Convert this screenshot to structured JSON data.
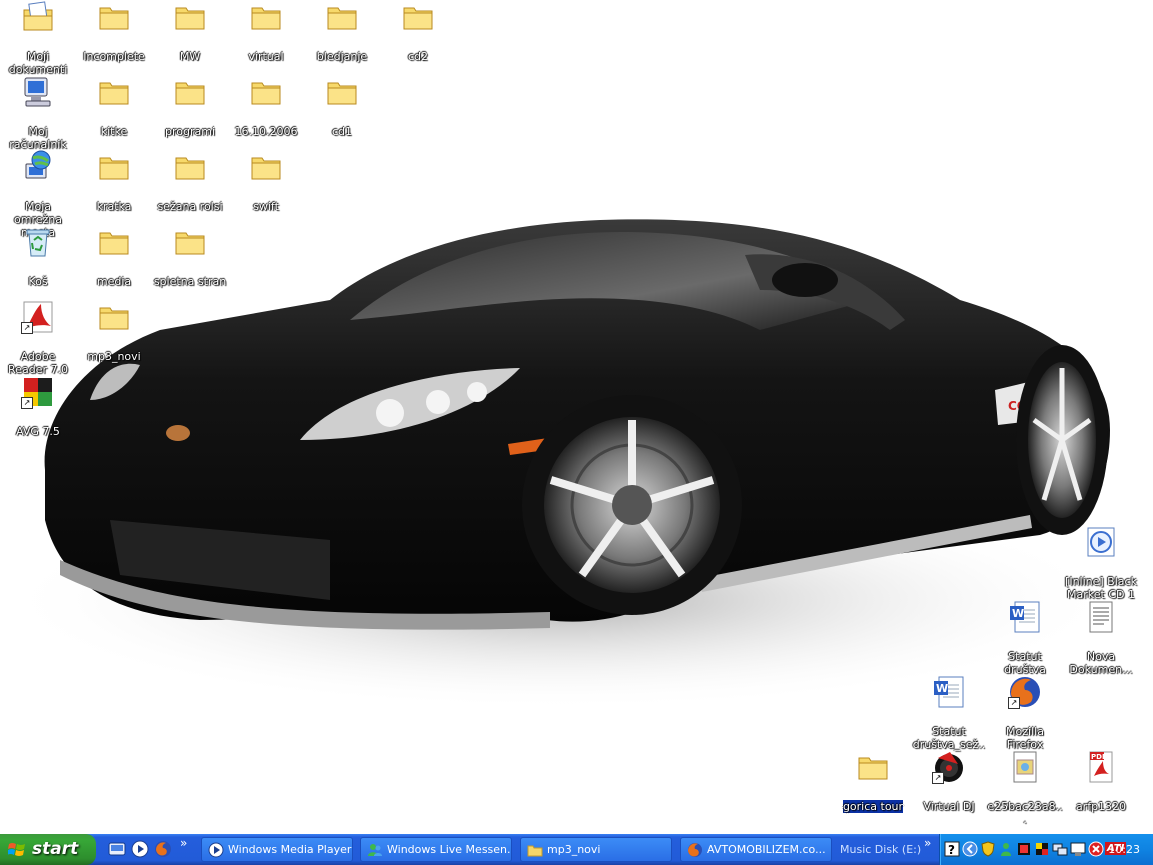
{
  "desktop": {
    "icons": [
      {
        "label": "Moji dokumenti",
        "icon": "my-documents-icon",
        "type": "folder-docs",
        "shortcut": false
      },
      {
        "label": "Incomplete",
        "icon": "folder-icon",
        "type": "folder",
        "shortcut": false
      },
      {
        "label": "MW",
        "icon": "folder-icon",
        "type": "folder",
        "shortcut": false
      },
      {
        "label": "virtual",
        "icon": "folder-icon",
        "type": "folder",
        "shortcut": false
      },
      {
        "label": "bledjanje",
        "icon": "folder-icon",
        "type": "folder",
        "shortcut": false
      },
      {
        "label": "cd2",
        "icon": "folder-icon",
        "type": "folder",
        "shortcut": false
      },
      {
        "label": "Moj računalnik",
        "icon": "my-computer-icon",
        "type": "computer",
        "shortcut": false
      },
      {
        "label": "kitke",
        "icon": "folder-icon",
        "type": "folder",
        "shortcut": false
      },
      {
        "label": "programi",
        "icon": "folder-icon",
        "type": "folder",
        "shortcut": false
      },
      {
        "label": "16.10.2006",
        "icon": "folder-icon",
        "type": "folder",
        "shortcut": false
      },
      {
        "label": "cd1",
        "icon": "folder-icon",
        "type": "folder",
        "shortcut": false
      },
      {
        "label": "Moja omrežna mesta",
        "icon": "network-places-icon",
        "type": "network",
        "shortcut": false
      },
      {
        "label": "kratka",
        "icon": "folder-icon",
        "type": "folder",
        "shortcut": false
      },
      {
        "label": "sežana rolsi",
        "icon": "folder-icon",
        "type": "folder",
        "shortcut": false
      },
      {
        "label": "swift",
        "icon": "folder-icon",
        "type": "folder",
        "shortcut": false
      },
      {
        "label": "Koš",
        "icon": "recycle-bin-icon",
        "type": "recycle",
        "shortcut": false
      },
      {
        "label": "media",
        "icon": "folder-icon",
        "type": "folder",
        "shortcut": false
      },
      {
        "label": "spletna stran",
        "icon": "folder-icon",
        "type": "folder",
        "shortcut": false
      },
      {
        "label": "Adobe Reader 7.0",
        "icon": "adobe-reader-icon",
        "type": "adobe",
        "shortcut": true
      },
      {
        "label": "mp3_novi",
        "icon": "folder-icon",
        "type": "folder",
        "shortcut": false
      },
      {
        "label": "AVG 7.5",
        "icon": "avg-icon",
        "type": "avg",
        "shortcut": true
      },
      {
        "label": "[Inline] Black Market CD 1",
        "icon": "media-cd-icon",
        "type": "mediacd",
        "shortcut": false
      },
      {
        "label": "Statut društva",
        "icon": "word-document-icon",
        "type": "word",
        "shortcut": false
      },
      {
        "label": "Nova Dokumen...",
        "icon": "text-document-icon",
        "type": "text",
        "shortcut": false
      },
      {
        "label": "Statut društva_sež...",
        "icon": "word-document-icon",
        "type": "word",
        "shortcut": false
      },
      {
        "label": "Mozilla Firefox",
        "icon": "firefox-icon",
        "type": "firefox",
        "shortcut": true
      },
      {
        "label": "gorica tour",
        "icon": "folder-icon",
        "type": "folder",
        "shortcut": false,
        "selected": true
      },
      {
        "label": "Virtual DJ",
        "icon": "virtual-dj-icon",
        "type": "vdj",
        "shortcut": true
      },
      {
        "label": "e25bac23a8...",
        "icon": "image-file-icon",
        "type": "image",
        "shortcut": false
      },
      {
        "label": "arfp1320",
        "icon": "pdf-file-icon",
        "type": "pdf",
        "shortcut": false
      }
    ]
  },
  "taskbar": {
    "start_label": "start",
    "quick_launch": [
      {
        "icon": "show-desktop-icon"
      },
      {
        "icon": "windows-media-player-icon"
      },
      {
        "icon": "firefox-icon"
      }
    ],
    "quick_launch_more": "»",
    "buttons": [
      {
        "label": "Windows Media Player",
        "icon": "windows-media-player-icon",
        "active": false
      },
      {
        "label": "Windows Live Messen...",
        "icon": "messenger-icon",
        "active": false
      },
      {
        "label": "mp3_novi",
        "icon": "folder-icon",
        "active": false
      },
      {
        "label": "AVTOMOBILIZEM.co...",
        "icon": "firefox-icon",
        "active": false
      }
    ],
    "toolbar_label": "Music Disk (E:)",
    "toolbar_more": "»",
    "tray_icons": [
      "help-icon",
      "show-hidden-icons-icon",
      "security-shield-icon",
      "messenger-icon",
      "app-icon",
      "app-icon",
      "network-icon",
      "display-icon",
      "antivirus-icon",
      "ati-icon"
    ],
    "ati_label": "ATI",
    "clock": "10:23"
  }
}
